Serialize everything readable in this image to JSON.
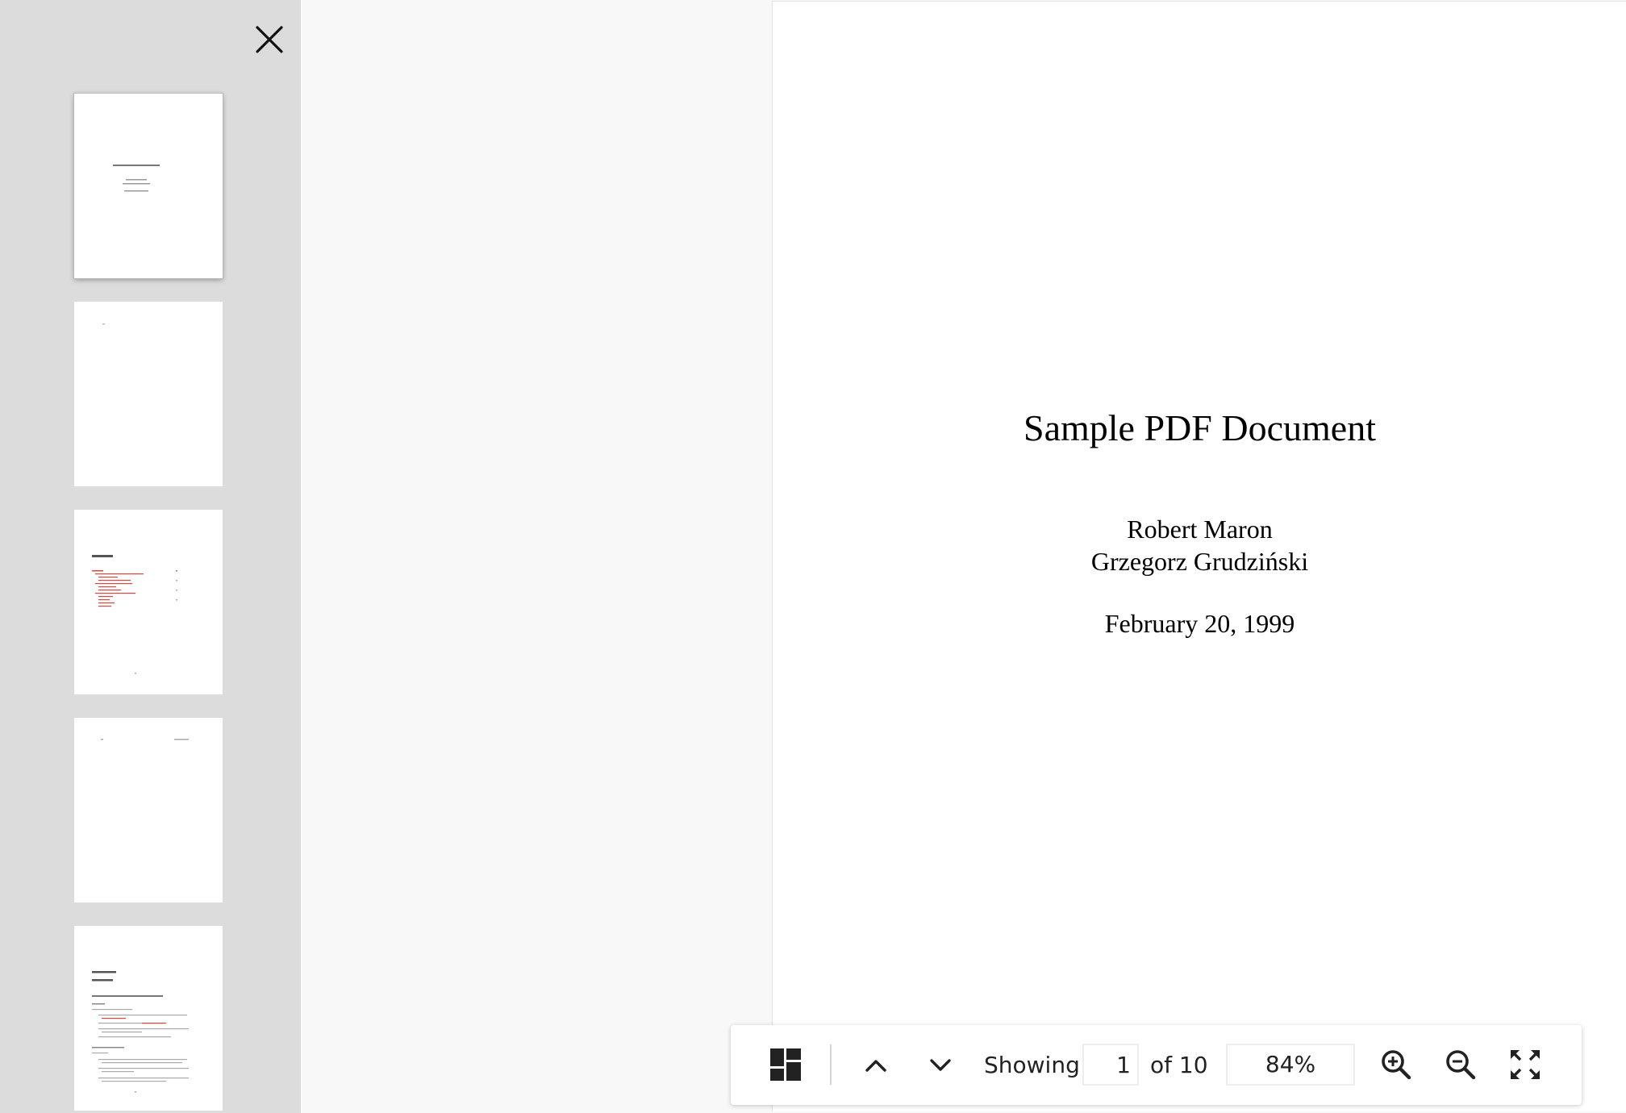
{
  "sidebar": {
    "close_icon": "close-icon",
    "thumbnails": [
      {
        "page": 1,
        "selected": true
      },
      {
        "page": 2,
        "selected": false
      },
      {
        "page": 3,
        "selected": false
      },
      {
        "page": 4,
        "selected": false
      },
      {
        "page": 5,
        "selected": false
      }
    ]
  },
  "document": {
    "title": "Sample PDF Document",
    "author_1": "Robert Maron",
    "author_2": "Grzegorz Grudziński",
    "date": "February 20, 1999"
  },
  "toolbar": {
    "thumbnails_icon": "thumbnails-grid-icon",
    "prev_icon": "chevron-up-icon",
    "next_icon": "chevron-down-icon",
    "showing_label": "Showing",
    "current_page": "1",
    "total_label": "of 10",
    "zoom_level": "84%",
    "zoom_in_icon": "zoom-in-icon",
    "zoom_out_icon": "zoom-out-icon",
    "fullscreen_icon": "fullscreen-icon"
  },
  "colors": {
    "sidebar_bg": "#dcdcdc",
    "viewer_bg": "#f8f8f8",
    "page_bg": "#ffffff",
    "thumb_link_red": "#e0453b"
  }
}
